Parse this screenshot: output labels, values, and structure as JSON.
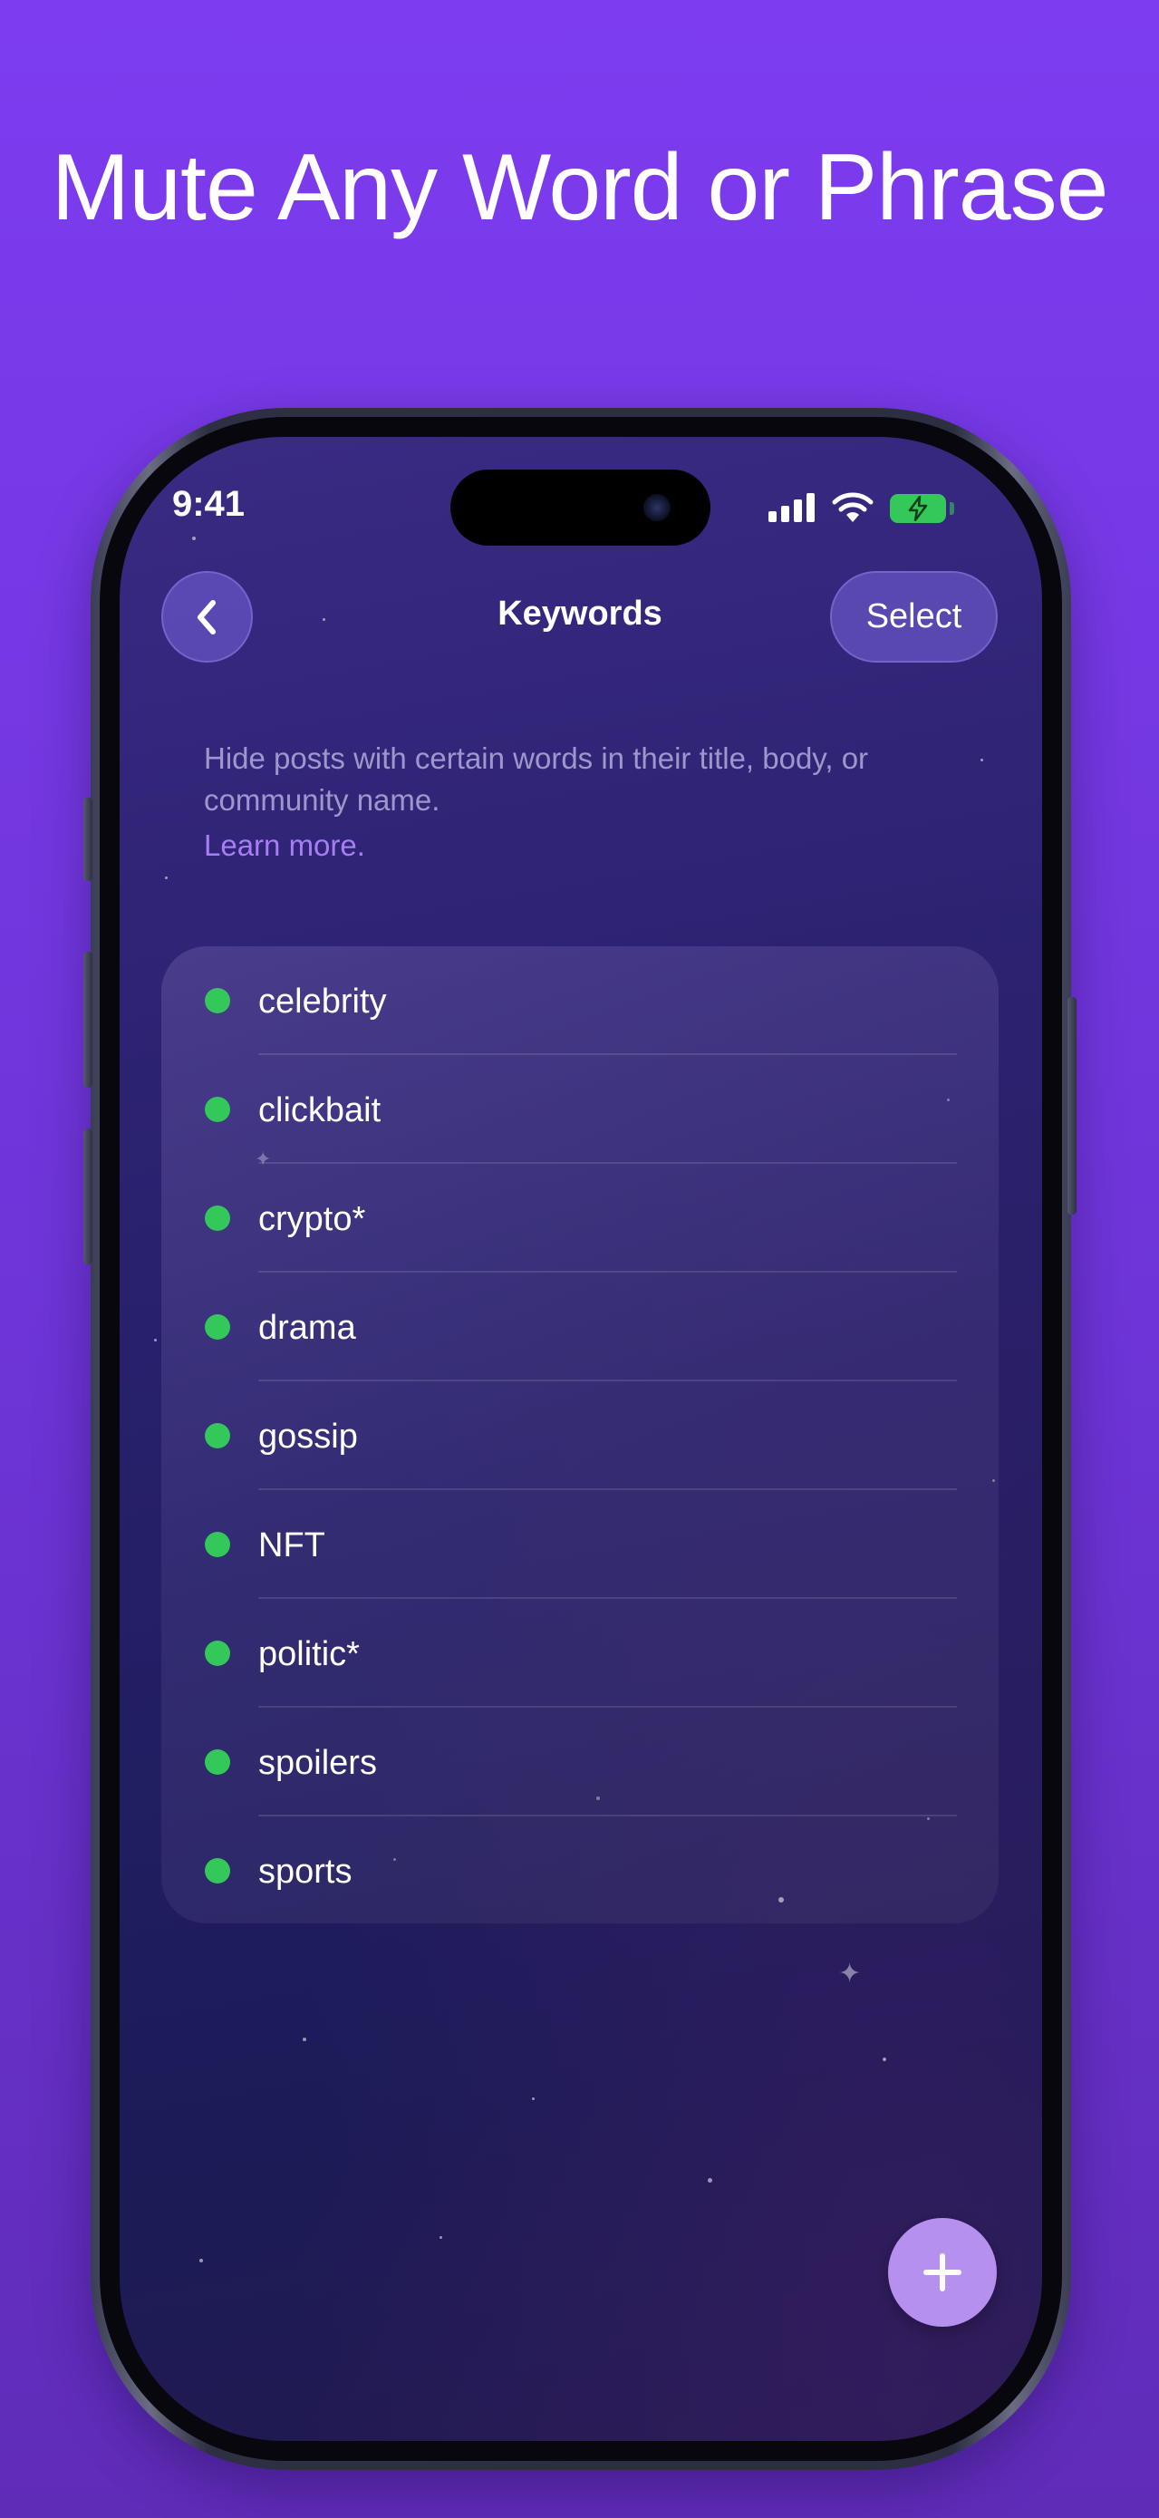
{
  "headline": "Mute Any Word or Phrase",
  "status_bar": {
    "time": "9:41",
    "signal_icon": "cellular-signal-icon",
    "wifi_icon": "wifi-icon",
    "battery_icon": "battery-charging-icon"
  },
  "nav": {
    "back_icon": "chevron-left-icon",
    "title": "Keywords",
    "select_label": "Select"
  },
  "description": "Hide posts with certain words in their title, body, or community name.",
  "learn_more": "Learn more.",
  "keywords": [
    {
      "label": "celebrity"
    },
    {
      "label": "clickbait"
    },
    {
      "label": "crypto*"
    },
    {
      "label": "drama"
    },
    {
      "label": "gossip"
    },
    {
      "label": "NFT"
    },
    {
      "label": "politic*"
    },
    {
      "label": "spoilers"
    },
    {
      "label": "sports"
    }
  ],
  "add_button_icon": "plus-icon",
  "colors": {
    "background": "#7d3cf0",
    "accent": "#a67df2",
    "active_dot": "#34c759",
    "add_button": "#b590ef"
  }
}
